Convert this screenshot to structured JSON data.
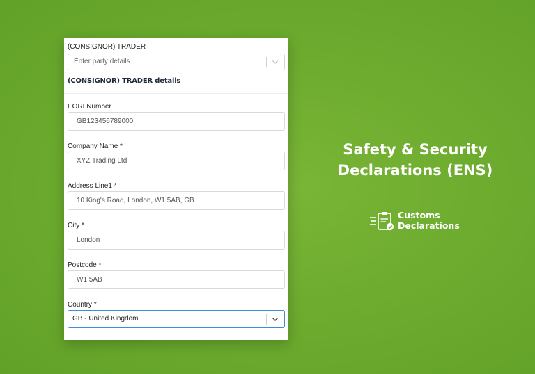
{
  "form": {
    "consignor_label": "(CONSIGNOR) TRADER",
    "party_select_placeholder": "Enter party details",
    "section_title": "(CONSIGNOR) TRADER details",
    "fields": [
      {
        "label": "EORI Number",
        "value": "GB123456789000"
      },
      {
        "label": "Company Name *",
        "value": "XYZ Trading Ltd"
      },
      {
        "label": "Address Line1 *",
        "value": "10 King's Road, London, W1 5AB, GB"
      },
      {
        "label": "City *",
        "value": "London"
      },
      {
        "label": "Postcode *",
        "value": "W1 5AB"
      }
    ],
    "country_label": "Country *",
    "country_value": "GB - United Kingdom"
  },
  "promo": {
    "heading_line1": "Safety & Security",
    "heading_line2": "Declarations (ENS)"
  },
  "brand": {
    "line1": "Customs",
    "line2": "Declarations",
    "icon": "clipboard-check-icon"
  },
  "colors": {
    "background": "#6aa92d",
    "focus_border": "#3d8bd9"
  }
}
